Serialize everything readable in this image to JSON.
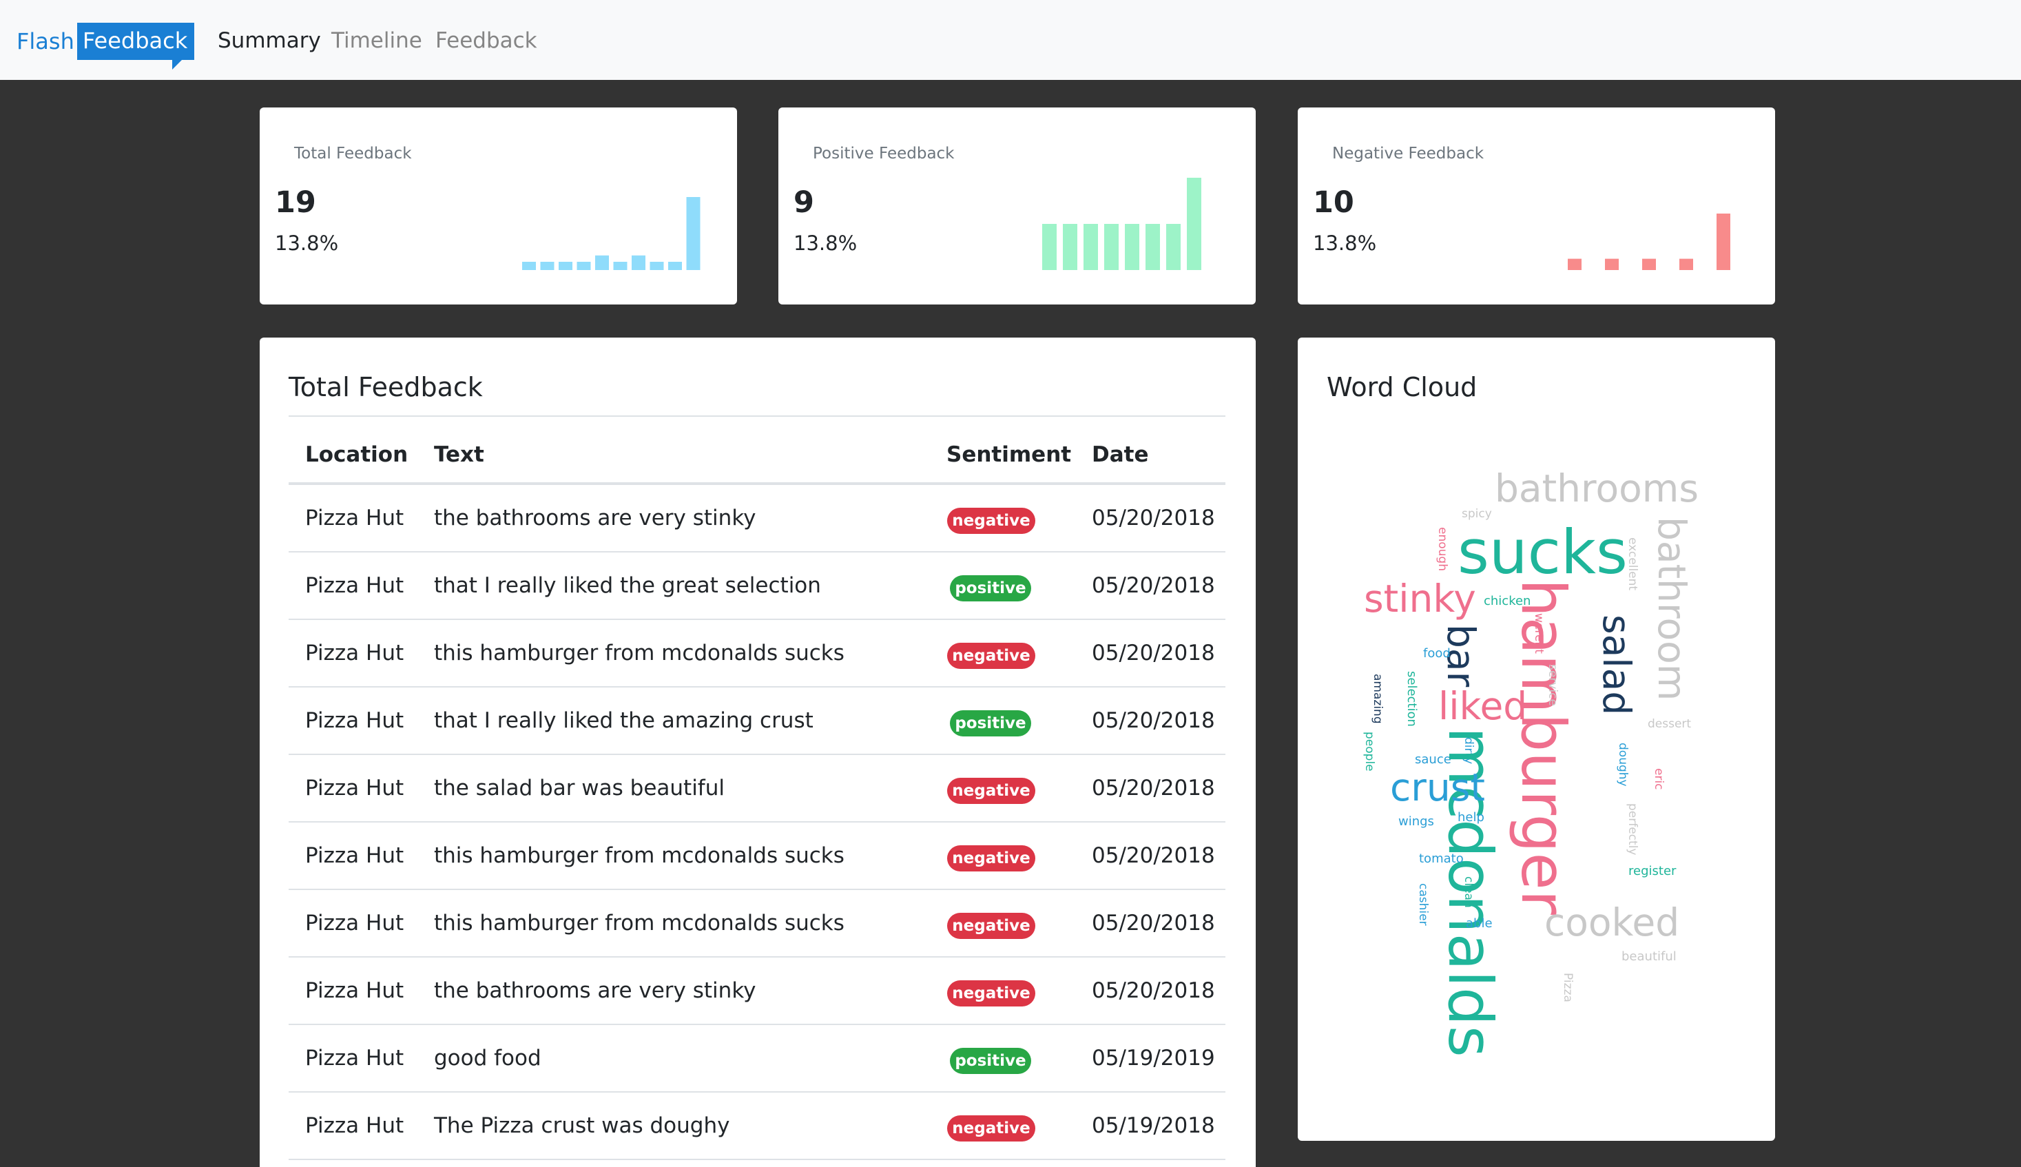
{
  "nav": {
    "brand_flash": "Flash",
    "brand_feedback": "Feedback",
    "links": [
      "Summary",
      "Timeline",
      "Feedback"
    ],
    "active": "Summary"
  },
  "stats": [
    {
      "label": "Total Feedback",
      "value": "19",
      "percent": "13.8%",
      "color": "#8fdcfb",
      "bars": [
        1,
        1,
        1,
        1,
        2,
        1,
        2,
        1,
        1,
        10
      ]
    },
    {
      "label": "Positive Feedback",
      "value": "9",
      "percent": "13.8%",
      "color": "#9df3c8",
      "bars": [
        5,
        5,
        5,
        5,
        5,
        5,
        5,
        10
      ]
    },
    {
      "label": "Negative Feedback",
      "value": "10",
      "percent": "13.8%",
      "color": "#f88b8b",
      "bars": [
        1,
        0,
        1,
        0,
        1,
        0,
        1,
        0,
        5
      ]
    }
  ],
  "table": {
    "title": "Total Feedback",
    "headers": [
      "Location",
      "Text",
      "Sentiment",
      "Date"
    ],
    "rows": [
      {
        "location": "Pizza Hut",
        "text": "the bathrooms are very stinky",
        "sentiment": "negative",
        "date": "05/20/2018"
      },
      {
        "location": "Pizza Hut",
        "text": "that I really liked the great selection",
        "sentiment": "positive",
        "date": "05/20/2018"
      },
      {
        "location": "Pizza Hut",
        "text": "this hamburger from mcdonalds sucks",
        "sentiment": "negative",
        "date": "05/20/2018"
      },
      {
        "location": "Pizza Hut",
        "text": "that I really liked the amazing crust",
        "sentiment": "positive",
        "date": "05/20/2018"
      },
      {
        "location": "Pizza Hut",
        "text": "the salad bar was beautiful",
        "sentiment": "negative",
        "date": "05/20/2018"
      },
      {
        "location": "Pizza Hut",
        "text": "this hamburger from mcdonalds sucks",
        "sentiment": "negative",
        "date": "05/20/2018"
      },
      {
        "location": "Pizza Hut",
        "text": "this hamburger from mcdonalds sucks",
        "sentiment": "negative",
        "date": "05/20/2018"
      },
      {
        "location": "Pizza Hut",
        "text": "the bathrooms are very stinky",
        "sentiment": "negative",
        "date": "05/20/2018"
      },
      {
        "location": "Pizza Hut",
        "text": "good food",
        "sentiment": "positive",
        "date": "05/19/2019"
      },
      {
        "location": "Pizza Hut",
        "text": "The Pizza crust was doughy",
        "sentiment": "negative",
        "date": "05/19/2018"
      }
    ]
  },
  "word_cloud": {
    "title": "Word Cloud",
    "colors": {
      "teal": "#1fb59a",
      "pink": "#ef6f8d",
      "gray": "#c8c8c8",
      "navy": "#1d3a5c",
      "blue": "#2a9ed6"
    },
    "words": [
      {
        "text": "bathrooms",
        "color": "gray"
      },
      {
        "text": "spicy",
        "color": "gray"
      },
      {
        "text": "sucks",
        "color": "teal"
      },
      {
        "text": "enough",
        "color": "pink"
      },
      {
        "text": "excellent",
        "color": "gray"
      },
      {
        "text": "bathroom",
        "color": "gray"
      },
      {
        "text": "stinky",
        "color": "pink"
      },
      {
        "text": "chicken",
        "color": "teal"
      },
      {
        "text": "hamburger",
        "color": "pink"
      },
      {
        "text": "salad",
        "color": "navy"
      },
      {
        "text": "werent",
        "color": "pink"
      },
      {
        "text": "service",
        "color": "gray"
      },
      {
        "text": "bar",
        "color": "navy"
      },
      {
        "text": "food",
        "color": "blue"
      },
      {
        "text": "amazing",
        "color": "navy"
      },
      {
        "text": "selection",
        "color": "teal"
      },
      {
        "text": "liked",
        "color": "pink"
      },
      {
        "text": "dessert",
        "color": "gray"
      },
      {
        "text": "people",
        "color": "teal"
      },
      {
        "text": "sauce",
        "color": "blue"
      },
      {
        "text": "dirty",
        "color": "blue"
      },
      {
        "text": "mcdonalds",
        "color": "teal"
      },
      {
        "text": "doughy",
        "color": "blue"
      },
      {
        "text": "eric",
        "color": "pink"
      },
      {
        "text": "crust",
        "color": "blue"
      },
      {
        "text": "wings",
        "color": "blue"
      },
      {
        "text": "help",
        "color": "blue"
      },
      {
        "text": "perfectly",
        "color": "gray"
      },
      {
        "text": "tomato",
        "color": "blue"
      },
      {
        "text": "register",
        "color": "teal"
      },
      {
        "text": "cashier",
        "color": "blue"
      },
      {
        "text": "clean",
        "color": "teal"
      },
      {
        "text": "cooked",
        "color": "gray"
      },
      {
        "text": "able",
        "color": "blue"
      },
      {
        "text": "beautiful",
        "color": "gray"
      },
      {
        "text": "Pizza",
        "color": "gray"
      }
    ]
  }
}
